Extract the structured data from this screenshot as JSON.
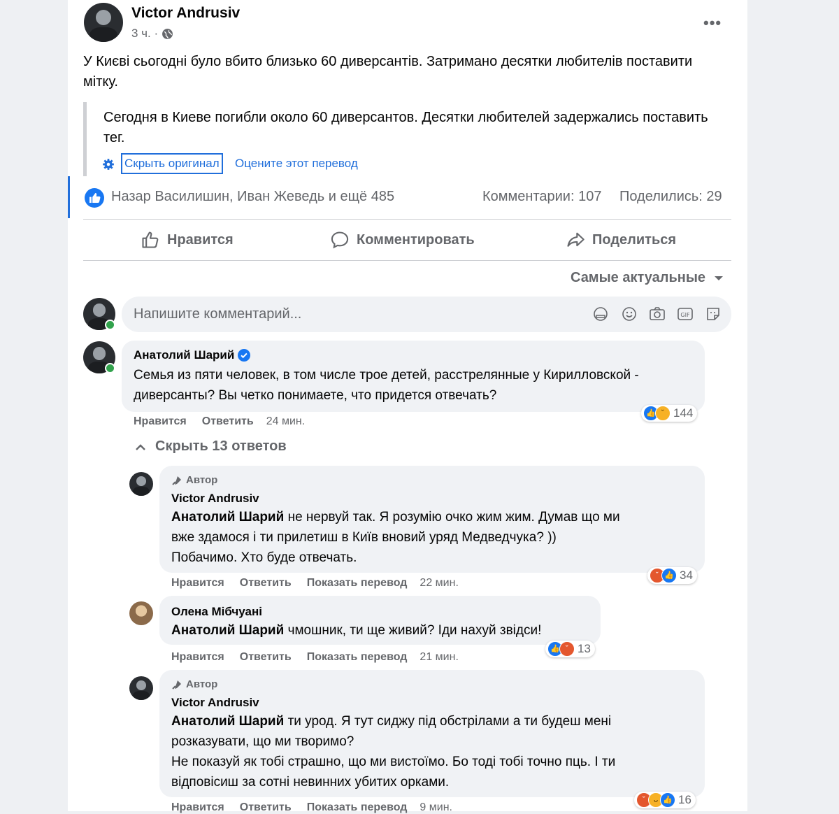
{
  "post": {
    "author": "Victor Andrusiv",
    "time": "3 ч. ·",
    "text": "У Києві сьогодні було вбито близько 60 диверсантів. Затримано десятки любителів поставити мітку.",
    "translation": "Сегодня в Киеве погибли около 60 диверсантов. Десятки любителей задержались поставить тег.",
    "hide_original": "Скрыть оригинал",
    "rate_translation": "Оцените этот перевод",
    "reactions_text": "Назар Василишин, Иван Жеведь и ещё 485",
    "comments_count": "Комментарии: 107",
    "shares_count": "Поделились: 29"
  },
  "actions": {
    "like": "Нравится",
    "comment": "Комментировать",
    "share": "Поделиться"
  },
  "sort_label": "Самые актуальные",
  "composer": {
    "placeholder": "Напишите комментарий..."
  },
  "comments": [
    {
      "author": "Анатолий Шарий",
      "text": "Семья из пяти человек, в том числе трое детей, расстрелянные у Кирилловской - диверсанты? Вы четко понимаете, что придется отвечать?",
      "like": "Нравится",
      "reply": "Ответить",
      "time": "24 мин.",
      "reaction_count": "144",
      "reaction_icons": [
        "like-icon",
        "sad-icon"
      ]
    }
  ],
  "hide_replies": "Скрыть 13 ответов",
  "replies": [
    {
      "badge": "Автор",
      "author": "Victor Andrusiv",
      "mention": "Анатолий Шарий",
      "text_l1": " не нервуй так. Я розумію очко жим жим. Думав що ми",
      "text_l2": "вже здамося і ти прилетиш в Київ вновий уряд Медведчука? ))",
      "text_l3": "Побачимо. Хто буде отвечать.",
      "like": "Нравится",
      "reply": "Ответить",
      "translate": "Показать перевод",
      "time": "22 мин.",
      "reaction_count": "34",
      "reaction_icons": [
        "angry-icon",
        "like-icon"
      ]
    },
    {
      "author": "Олена Мібчуані",
      "mention": "Анатолий Шарий",
      "text_l1": " чмошник, ти ще живий? Іди нахуй звідси!",
      "like": "Нравится",
      "reply": "Ответить",
      "translate": "Показать перевод",
      "time": "21 мин.",
      "reaction_count": "13",
      "reaction_icons": [
        "like-icon",
        "angry-icon"
      ]
    },
    {
      "badge": "Автор",
      "author": "Victor Andrusiv",
      "mention": "Анатолий Шарий",
      "text_l1": " ти урод. Я тут сиджу під обстрілами а ти будеш мені",
      "text_l2": "розказувати, що ми творимо?",
      "text_l3": "Не показуй як тобі страшно, що ми вистоїмо. Бо тоді тобі точно пць. І ти",
      "text_l4": "відповісиш за сотні невинних убитих орками.",
      "like": "Нравится",
      "reply": "Ответить",
      "translate": "Показать перевод",
      "time": "9 мин.",
      "reaction_count": "16",
      "reaction_icons": [
        "angry-icon",
        "haha-icon",
        "like-icon"
      ]
    }
  ]
}
